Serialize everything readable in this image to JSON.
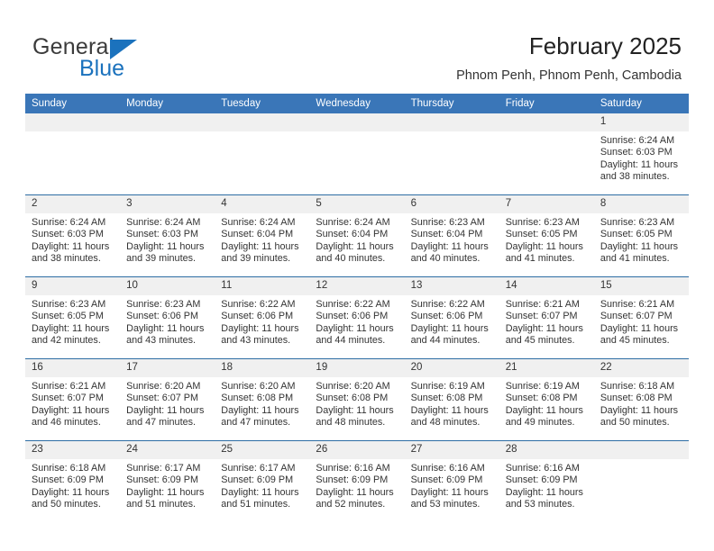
{
  "brand": {
    "name_part1": "General",
    "name_part2": "Blue",
    "accent_color": "#1b72bd"
  },
  "header": {
    "title": "February 2025",
    "subtitle": "Phnom Penh, Phnom Penh, Cambodia"
  },
  "theme": {
    "header_blue": "#3a76b8",
    "daynum_band": "#f0f0f0",
    "row_divider": "#2d6da4"
  },
  "weekday_headers": [
    "Sunday",
    "Monday",
    "Tuesday",
    "Wednesday",
    "Thursday",
    "Friday",
    "Saturday"
  ],
  "labels": {
    "sunrise_prefix": "Sunrise:",
    "sunset_prefix": "Sunset:",
    "daylight_prefix": "Daylight:"
  },
  "weeks": [
    [
      {
        "day": "",
        "empty": true
      },
      {
        "day": "",
        "empty": true
      },
      {
        "day": "",
        "empty": true
      },
      {
        "day": "",
        "empty": true
      },
      {
        "day": "",
        "empty": true
      },
      {
        "day": "",
        "empty": true
      },
      {
        "day": "1",
        "sunrise": "Sunrise: 6:24 AM",
        "sunset": "Sunset: 6:03 PM",
        "daylight_line1": "Daylight: 11 hours",
        "daylight_line2": "and 38 minutes."
      }
    ],
    [
      {
        "day": "2",
        "sunrise": "Sunrise: 6:24 AM",
        "sunset": "Sunset: 6:03 PM",
        "daylight_line1": "Daylight: 11 hours",
        "daylight_line2": "and 38 minutes."
      },
      {
        "day": "3",
        "sunrise": "Sunrise: 6:24 AM",
        "sunset": "Sunset: 6:03 PM",
        "daylight_line1": "Daylight: 11 hours",
        "daylight_line2": "and 39 minutes."
      },
      {
        "day": "4",
        "sunrise": "Sunrise: 6:24 AM",
        "sunset": "Sunset: 6:04 PM",
        "daylight_line1": "Daylight: 11 hours",
        "daylight_line2": "and 39 minutes."
      },
      {
        "day": "5",
        "sunrise": "Sunrise: 6:24 AM",
        "sunset": "Sunset: 6:04 PM",
        "daylight_line1": "Daylight: 11 hours",
        "daylight_line2": "and 40 minutes."
      },
      {
        "day": "6",
        "sunrise": "Sunrise: 6:23 AM",
        "sunset": "Sunset: 6:04 PM",
        "daylight_line1": "Daylight: 11 hours",
        "daylight_line2": "and 40 minutes."
      },
      {
        "day": "7",
        "sunrise": "Sunrise: 6:23 AM",
        "sunset": "Sunset: 6:05 PM",
        "daylight_line1": "Daylight: 11 hours",
        "daylight_line2": "and 41 minutes."
      },
      {
        "day": "8",
        "sunrise": "Sunrise: 6:23 AM",
        "sunset": "Sunset: 6:05 PM",
        "daylight_line1": "Daylight: 11 hours",
        "daylight_line2": "and 41 minutes."
      }
    ],
    [
      {
        "day": "9",
        "sunrise": "Sunrise: 6:23 AM",
        "sunset": "Sunset: 6:05 PM",
        "daylight_line1": "Daylight: 11 hours",
        "daylight_line2": "and 42 minutes."
      },
      {
        "day": "10",
        "sunrise": "Sunrise: 6:23 AM",
        "sunset": "Sunset: 6:06 PM",
        "daylight_line1": "Daylight: 11 hours",
        "daylight_line2": "and 43 minutes."
      },
      {
        "day": "11",
        "sunrise": "Sunrise: 6:22 AM",
        "sunset": "Sunset: 6:06 PM",
        "daylight_line1": "Daylight: 11 hours",
        "daylight_line2": "and 43 minutes."
      },
      {
        "day": "12",
        "sunrise": "Sunrise: 6:22 AM",
        "sunset": "Sunset: 6:06 PM",
        "daylight_line1": "Daylight: 11 hours",
        "daylight_line2": "and 44 minutes."
      },
      {
        "day": "13",
        "sunrise": "Sunrise: 6:22 AM",
        "sunset": "Sunset: 6:06 PM",
        "daylight_line1": "Daylight: 11 hours",
        "daylight_line2": "and 44 minutes."
      },
      {
        "day": "14",
        "sunrise": "Sunrise: 6:21 AM",
        "sunset": "Sunset: 6:07 PM",
        "daylight_line1": "Daylight: 11 hours",
        "daylight_line2": "and 45 minutes."
      },
      {
        "day": "15",
        "sunrise": "Sunrise: 6:21 AM",
        "sunset": "Sunset: 6:07 PM",
        "daylight_line1": "Daylight: 11 hours",
        "daylight_line2": "and 45 minutes."
      }
    ],
    [
      {
        "day": "16",
        "sunrise": "Sunrise: 6:21 AM",
        "sunset": "Sunset: 6:07 PM",
        "daylight_line1": "Daylight: 11 hours",
        "daylight_line2": "and 46 minutes."
      },
      {
        "day": "17",
        "sunrise": "Sunrise: 6:20 AM",
        "sunset": "Sunset: 6:07 PM",
        "daylight_line1": "Daylight: 11 hours",
        "daylight_line2": "and 47 minutes."
      },
      {
        "day": "18",
        "sunrise": "Sunrise: 6:20 AM",
        "sunset": "Sunset: 6:08 PM",
        "daylight_line1": "Daylight: 11 hours",
        "daylight_line2": "and 47 minutes."
      },
      {
        "day": "19",
        "sunrise": "Sunrise: 6:20 AM",
        "sunset": "Sunset: 6:08 PM",
        "daylight_line1": "Daylight: 11 hours",
        "daylight_line2": "and 48 minutes."
      },
      {
        "day": "20",
        "sunrise": "Sunrise: 6:19 AM",
        "sunset": "Sunset: 6:08 PM",
        "daylight_line1": "Daylight: 11 hours",
        "daylight_line2": "and 48 minutes."
      },
      {
        "day": "21",
        "sunrise": "Sunrise: 6:19 AM",
        "sunset": "Sunset: 6:08 PM",
        "daylight_line1": "Daylight: 11 hours",
        "daylight_line2": "and 49 minutes."
      },
      {
        "day": "22",
        "sunrise": "Sunrise: 6:18 AM",
        "sunset": "Sunset: 6:08 PM",
        "daylight_line1": "Daylight: 11 hours",
        "daylight_line2": "and 50 minutes."
      }
    ],
    [
      {
        "day": "23",
        "sunrise": "Sunrise: 6:18 AM",
        "sunset": "Sunset: 6:09 PM",
        "daylight_line1": "Daylight: 11 hours",
        "daylight_line2": "and 50 minutes."
      },
      {
        "day": "24",
        "sunrise": "Sunrise: 6:17 AM",
        "sunset": "Sunset: 6:09 PM",
        "daylight_line1": "Daylight: 11 hours",
        "daylight_line2": "and 51 minutes."
      },
      {
        "day": "25",
        "sunrise": "Sunrise: 6:17 AM",
        "sunset": "Sunset: 6:09 PM",
        "daylight_line1": "Daylight: 11 hours",
        "daylight_line2": "and 51 minutes."
      },
      {
        "day": "26",
        "sunrise": "Sunrise: 6:16 AM",
        "sunset": "Sunset: 6:09 PM",
        "daylight_line1": "Daylight: 11 hours",
        "daylight_line2": "and 52 minutes."
      },
      {
        "day": "27",
        "sunrise": "Sunrise: 6:16 AM",
        "sunset": "Sunset: 6:09 PM",
        "daylight_line1": "Daylight: 11 hours",
        "daylight_line2": "and 53 minutes."
      },
      {
        "day": "28",
        "sunrise": "Sunrise: 6:16 AM",
        "sunset": "Sunset: 6:09 PM",
        "daylight_line1": "Daylight: 11 hours",
        "daylight_line2": "and 53 minutes."
      },
      {
        "day": "",
        "empty": true
      }
    ]
  ]
}
